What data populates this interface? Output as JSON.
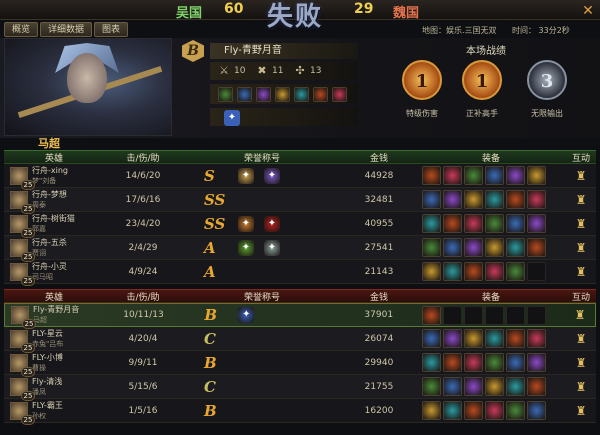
{
  "header": {
    "team_left": "吴国",
    "score_left": "60",
    "result": "失败",
    "score_right": "29",
    "team_right": "魏国",
    "close": "✕"
  },
  "tabs": [
    "概览",
    "详细数据",
    "图表"
  ],
  "meta": {
    "map": "地图：娱乐.三国无双",
    "time": "时间：   33分2秒"
  },
  "summary": {
    "hero_name": "马超",
    "grade": "B",
    "player": "Fly-青野月音",
    "stats": [
      {
        "icon": "swords-icon",
        "glyph": "⚔",
        "value": "10"
      },
      {
        "icon": "crossed-hammers-icon",
        "glyph": "✖",
        "value": "11"
      },
      {
        "icon": "compass-icon",
        "glyph": "✣",
        "value": "13"
      }
    ],
    "honor_heading": "本场战绩",
    "medals": [
      {
        "glyph": "1",
        "label": "特级伤害"
      },
      {
        "glyph": "1",
        "label": "正补高手"
      },
      {
        "glyph": "3",
        "label": "无限输出"
      }
    ]
  },
  "table_headers": {
    "hero": "英雄",
    "kda": "击/伤/助",
    "honor": "荣誉称号",
    "gold": "金钱",
    "equip": "装备",
    "act": "互动"
  },
  "team_a": [
    {
      "name": "行舟-xing",
      "hero": "梦\"刘备",
      "lvl": "25",
      "kda": "14/6/20",
      "grade": "S",
      "gold": "44928",
      "badges": [
        "#c8a050",
        "#7a5ac8"
      ]
    },
    {
      "name": "行舟-梦想",
      "hero": "周泰",
      "lvl": "25",
      "kda": "17/6/16",
      "grade": "SS",
      "gold": "32481",
      "badges": []
    },
    {
      "name": "行舟-树街猫",
      "hero": "郭嘉",
      "lvl": "25",
      "kda": "23/4/20",
      "grade": "SS",
      "gold": "40955",
      "badges": [
        "#c87a30",
        "#b82020"
      ]
    },
    {
      "name": "行舟-五杀",
      "hero": "贾诩",
      "lvl": "25",
      "kda": "2/4/29",
      "grade": "A",
      "gold": "27541",
      "badges": [
        "#5aa030",
        "#8aa0a0"
      ]
    },
    {
      "name": "行舟-小灵",
      "hero": "司马昭",
      "lvl": "25",
      "kda": "4/9/24",
      "grade": "A",
      "gold": "21143",
      "badges": []
    }
  ],
  "team_b": [
    {
      "name": "Fly-青野月音",
      "hero": "马超",
      "lvl": "25",
      "kda": "10/11/13",
      "grade": "B",
      "gold": "37901",
      "badges": [
        "#3a60b8"
      ],
      "self": true
    },
    {
      "name": "FLY-星云",
      "hero": "赤兔\"吕布",
      "lvl": "25",
      "kda": "4/20/4",
      "grade": "C",
      "gold": "26074",
      "badges": []
    },
    {
      "name": "FLY-小博",
      "hero": "曹操",
      "lvl": "25",
      "kda": "9/9/11",
      "grade": "B",
      "gold": "29940",
      "badges": []
    },
    {
      "name": "Fly-清浅",
      "hero": "潘凤",
      "lvl": "25",
      "kda": "5/15/6",
      "grade": "C",
      "gold": "21755",
      "badges": []
    },
    {
      "name": "FLY-霸王",
      "hero": "孙权",
      "lvl": "25",
      "kda": "1/5/16",
      "grade": "B",
      "gold": "16200",
      "badges": []
    }
  ],
  "colors": {
    "slot_palette": [
      "#b84a20",
      "#c83a5a",
      "#4a8a3a",
      "#3a6ab8",
      "#8a4ac8",
      "#c89a30",
      "#2a9aa0"
    ]
  },
  "interact_icon": "bell-icon"
}
